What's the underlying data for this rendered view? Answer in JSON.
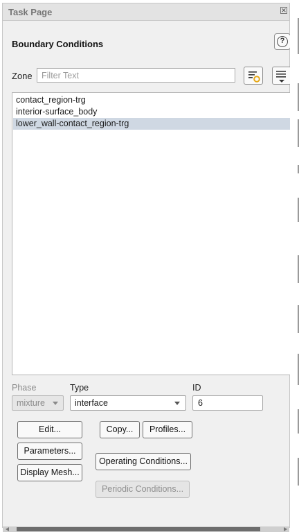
{
  "window": {
    "title": "Task Page"
  },
  "header": {
    "title": "Boundary Conditions",
    "help_symbol": "?"
  },
  "zone": {
    "label": "Zone",
    "filter_placeholder": "Filter Text",
    "filter_value": "",
    "list": [
      "contact_region-trg",
      "interior-surface_body",
      "lower_wall-contact_region-trg"
    ],
    "selected_index": 2
  },
  "phase": {
    "label": "Phase",
    "value": "mixture",
    "enabled": false
  },
  "type": {
    "label": "Type",
    "value": "interface"
  },
  "id": {
    "label": "ID",
    "value": "6"
  },
  "buttons": {
    "edit": "Edit...",
    "copy": "Copy...",
    "profiles": "Profiles...",
    "parameters": "Parameters...",
    "operating_conditions": "Operating Conditions...",
    "display_mesh": "Display Mesh...",
    "periodic_conditions": "Periodic Conditions..."
  },
  "icons": {
    "close": "close-icon",
    "help": "help-icon",
    "filter_options": "filter-options-icon",
    "list_menu": "list-menu-icon",
    "dropdown": "chevron-down-icon"
  },
  "colors": {
    "panel_bg": "#f0f0f0",
    "selected_row": "#cfd8e3",
    "filter_accent": "#e6a817"
  }
}
